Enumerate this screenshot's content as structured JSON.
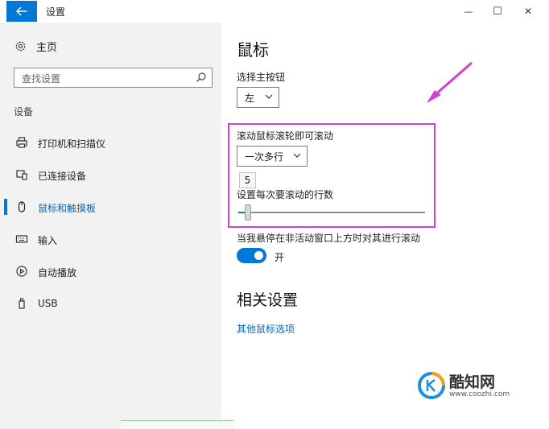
{
  "window": {
    "title": "设置",
    "minimize_glyph": "—",
    "maximize_glyph": "☐",
    "close_glyph": "✕"
  },
  "sidebar": {
    "home_label": "主页",
    "search_placeholder": "查找设置",
    "section_title": "设备",
    "items": [
      {
        "label": "打印机和扫描仪",
        "icon": "printer-icon"
      },
      {
        "label": "已连接设备",
        "icon": "connected-devices-icon"
      },
      {
        "label": "鼠标和触摸板",
        "icon": "mouse-icon",
        "active": true
      },
      {
        "label": "输入",
        "icon": "keyboard-icon"
      },
      {
        "label": "自动播放",
        "icon": "autoplay-icon"
      },
      {
        "label": "USB",
        "icon": "usb-icon"
      }
    ]
  },
  "main": {
    "title": "鼠标",
    "primary_button": {
      "label": "选择主按钮",
      "value": "左"
    },
    "scroll_mode": {
      "label": "滚动鼠标滚轮即可滚动",
      "value": "一次多行"
    },
    "lines_tooltip": "5",
    "lines_label": "设置每次要滚动的行数",
    "lines_value": 5,
    "lines_max": 100,
    "inactive_scroll": {
      "label": "当我悬停在非活动窗口上方时对其进行滚动",
      "state": "开",
      "on": true
    },
    "related_title": "相关设置",
    "related_link": "其他鼠标选项"
  },
  "colors": {
    "accent": "#0078d7",
    "annotation": "#d23fd4"
  },
  "watermark": {
    "brand": "酷知网",
    "url": "www.coozhi.com"
  }
}
